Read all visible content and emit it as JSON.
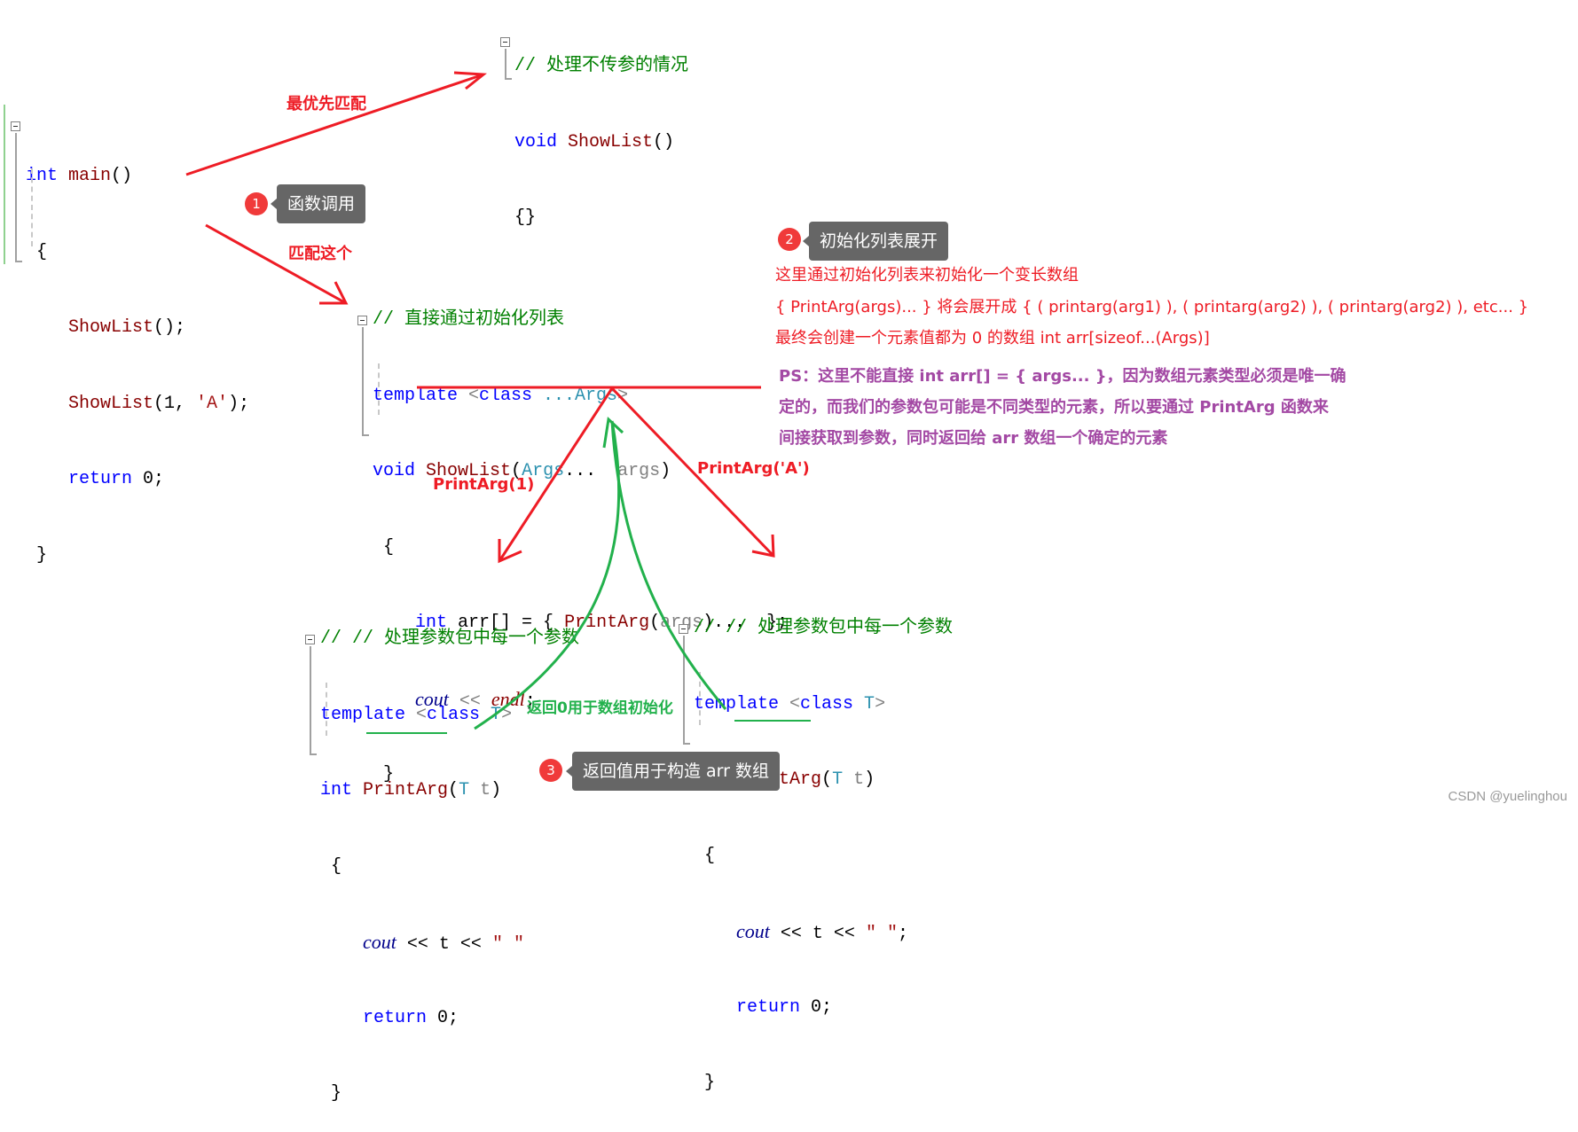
{
  "empty_showlist": {
    "comment": "// 处理不传参的情况",
    "sig_kw": "void",
    "sig_name": "ShowList",
    "sig_parens": "()",
    "body": "{}"
  },
  "main_func": {
    "sig_kw": "int",
    "sig_name": "main",
    "sig_parens": "()",
    "open": "{",
    "call1_name": "ShowList",
    "call1_rest": "();",
    "call2_name": "ShowList",
    "call2_rest": "(1, ",
    "call2_char": "'A'",
    "call2_end": ");",
    "ret_kw": "return",
    "ret_val": " 0;",
    "close": "}"
  },
  "variadic_showlist": {
    "comment": "// 直接通过初始化列表",
    "tpl_kw": "template",
    "tpl_lt": " <",
    "tpl_class": "class",
    "tpl_args": " ...Args",
    "tpl_gt": ">",
    "sig_kw": "void",
    "sig_name": " ShowList",
    "sig_open": "(",
    "sig_type": "Args",
    "sig_dots": "...",
    "sig_param": "  args",
    "sig_close": ")",
    "open": "{",
    "arr_kw": "int",
    "arr_rest": " arr[] = { ",
    "arr_fn": "PrintArg",
    "arr_po": "(",
    "arr_param": "args",
    "arr_end": ")...  };",
    "cout": "cout",
    "cout_op": " << ",
    "endl": "endl",
    "semi": ";",
    "close": "}"
  },
  "printarg_left": {
    "comment": "// // 处理参数包中每一个参数",
    "tpl_kw": "template",
    "tpl_lt": " <",
    "tpl_class": "class",
    "tpl_t": " T",
    "tpl_gt": ">",
    "sig_kw": "int",
    "sig_name": " PrintArg",
    "sig_open": "(",
    "sig_type": "T",
    "sig_param": " t",
    "sig_close": ")",
    "open": "{",
    "cout": "cout",
    "cout_rest": " << t << ",
    "str": "\" \"",
    "ret_kw": "return",
    "ret_val": " 0;",
    "close": "}"
  },
  "printarg_right": {
    "comment": "// // 处理参数包中每一个参数",
    "tpl_kw": "template",
    "tpl_lt": " <",
    "tpl_class": "class",
    "tpl_t": " T",
    "tpl_gt": ">",
    "sig_kw": "int",
    "sig_name": " PrintArg",
    "sig_open": "(",
    "sig_type": "T",
    "sig_param": " t",
    "sig_close": ")",
    "open": "{",
    "cout": "cout",
    "cout_rest": " << t << ",
    "str": "\" \"",
    "semi": ";",
    "ret_kw": "return",
    "ret_val": " 0;",
    "close": "}"
  },
  "annotations": {
    "highest_priority": "最优先匹配",
    "match_this": "匹配这个",
    "printarg_1": "PrintArg(1)",
    "printarg_a": "PrintArg('A')",
    "return_zero": "返回0用于数组初始化"
  },
  "callouts": [
    {
      "number": "1",
      "text": "函数调用"
    },
    {
      "number": "2",
      "text": "初始化列表展开"
    },
    {
      "number": "3",
      "text": "返回值用于构造 arr 数组"
    }
  ],
  "notes": {
    "red": [
      "这里通过初始化列表来初始化一个变长数组",
      "{ PrintArg(args)... } 将会展开成 { ( printarg(arg1) ), ( printarg(arg2) ), ( printarg(arg2) ), etc... }",
      "最终会创建一个元素值都为 0 的数组 int arr[sizeof...(Args)]"
    ],
    "purple": [
      "PS：这里不能直接 int arr[] = { args... }，因为数组元素类型必须是唯一确",
      "定的，而我们的参数包可能是不同类型的元素，所以要通过 PrintArg 函数来",
      "间接获取到参数，同时返回给 arr 数组一个确定的元素"
    ]
  },
  "colors": {
    "arrow_red": "#ee1c25",
    "arrow_green": "#22b14c",
    "note_purple": "#a349a4",
    "callout_bg": "#666666",
    "badge_red": "#f03a3a"
  },
  "watermark": "CSDN @yuelinghou"
}
